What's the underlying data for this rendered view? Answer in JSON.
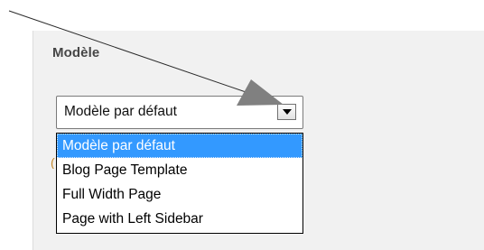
{
  "template_section": {
    "title": "Modèle",
    "select": {
      "current_value": "Modèle par défaut",
      "options": [
        {
          "label": "Modèle par défaut",
          "selected": true
        },
        {
          "label": "Blog Page Template",
          "selected": false
        },
        {
          "label": "Full Width Page",
          "selected": false
        },
        {
          "label": "Page with Left Sidebar",
          "selected": false
        }
      ]
    }
  },
  "icons": {
    "dropdown_arrow": "chevron-down-icon",
    "annotation_arrow": "callout-arrow"
  },
  "colors": {
    "selected_option_bg": "#3399ff",
    "panel_bg": "#f1f1f1",
    "annotation_arrow": "#808080"
  }
}
